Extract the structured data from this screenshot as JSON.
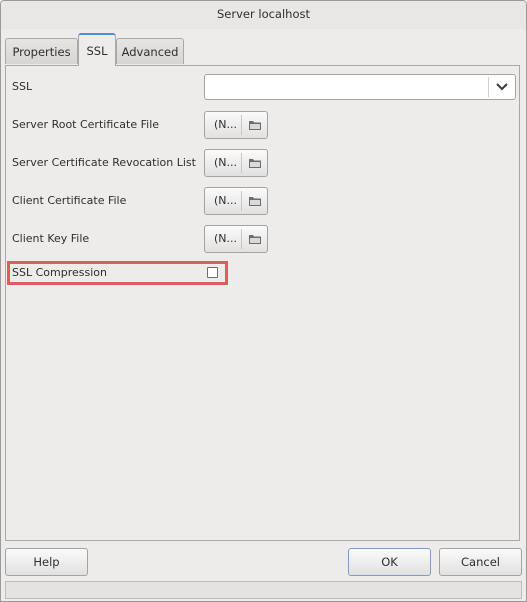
{
  "window": {
    "title": "Server localhost"
  },
  "tabs": [
    {
      "label": "Properties",
      "active": false
    },
    {
      "label": "SSL",
      "active": true
    },
    {
      "label": "Advanced",
      "active": false
    }
  ],
  "ssl_tab": {
    "ssl_mode": {
      "label": "SSL",
      "value": ""
    },
    "server_root_cert": {
      "label": "Server Root Certificate File",
      "button_text": "(N..."
    },
    "server_crl": {
      "label": "Server Certificate Revocation List",
      "button_text": "(N..."
    },
    "client_cert": {
      "label": "Client Certificate File",
      "button_text": "(N..."
    },
    "client_key": {
      "label": "Client Key File",
      "button_text": "(N..."
    },
    "ssl_compression": {
      "label": "SSL Compression",
      "checked": false
    }
  },
  "buttons": {
    "help": "Help",
    "ok": "OK",
    "cancel": "Cancel"
  },
  "colors": {
    "accent": "#4a90d9",
    "highlight": "#e05c5c"
  },
  "icons": {
    "combo_arrow": "chevron-down-icon",
    "file_browse": "folder-icon"
  }
}
